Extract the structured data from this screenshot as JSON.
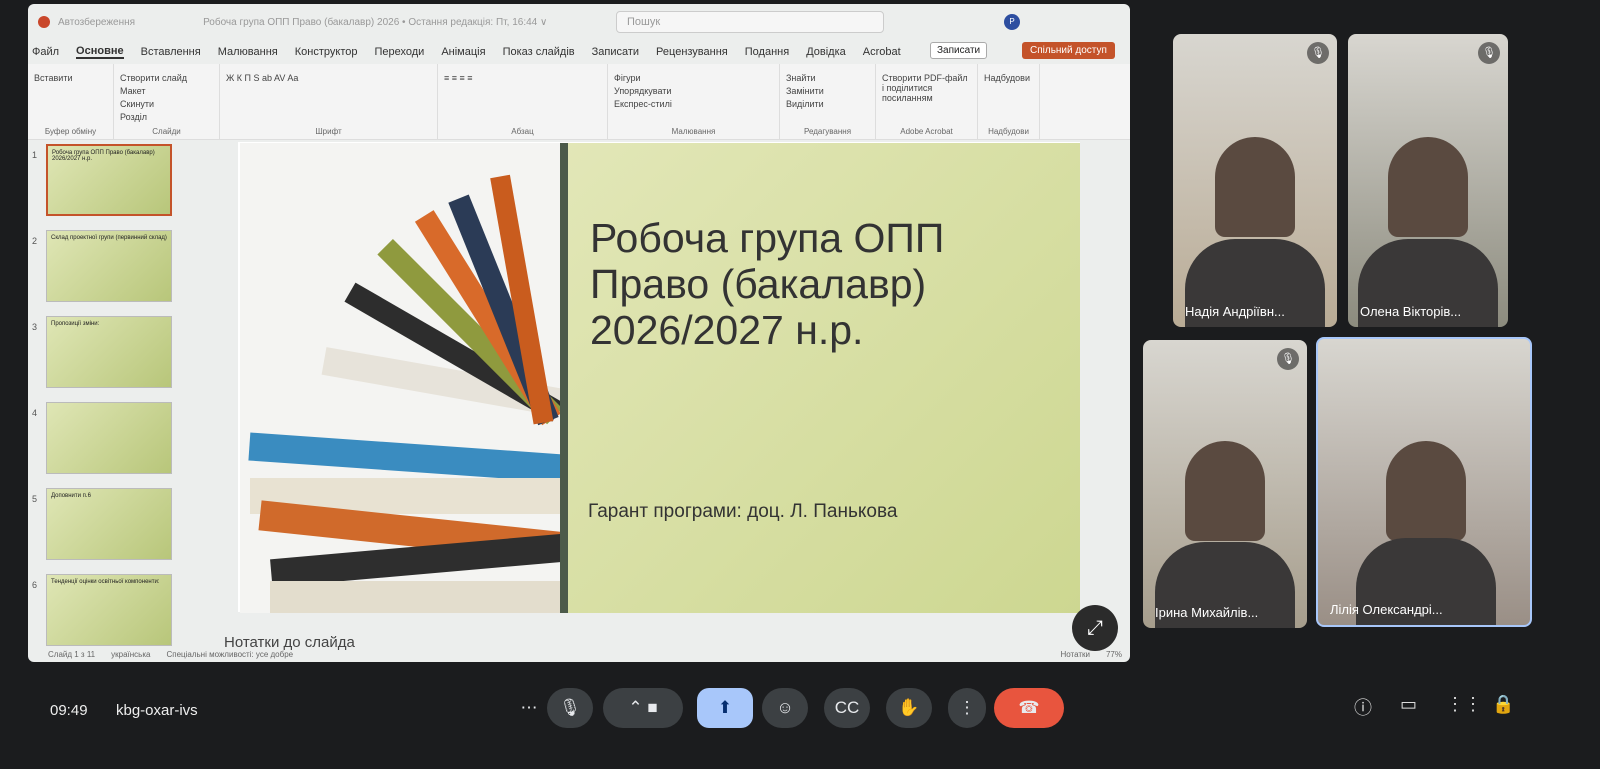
{
  "ppt": {
    "autosave": "Автозбереження",
    "doc_title": "Робоча група ОПП Право (бакалавр) 2026 • Остання редакція: Пт, 16:44 ∨",
    "search_placeholder": "Пошук",
    "avatar": "P",
    "menu": [
      "Файл",
      "Основне",
      "Вставлення",
      "Малювання",
      "Конструктор",
      "Переходи",
      "Анімація",
      "Показ слайдів",
      "Записати",
      "Рецензування",
      "Подання",
      "Довідка",
      "Acrobat"
    ],
    "record": "Записати",
    "share": "Спільний доступ",
    "ribbon": [
      {
        "label": "Буфер обміну",
        "items": [
          "Вставити"
        ]
      },
      {
        "label": "Слайди",
        "items": [
          "Створити слайд",
          "Макет",
          "Скинути",
          "Розділ"
        ]
      },
      {
        "label": "Шрифт",
        "items": [
          "Ж  К  П  S  ab  AV  Aa"
        ]
      },
      {
        "label": "Абзац",
        "items": [
          "≡ ≡ ≡ ≡"
        ]
      },
      {
        "label": "Малювання",
        "items": [
          "Фігури",
          "Упорядкувати",
          "Експрес-стилі"
        ]
      },
      {
        "label": "Редагування",
        "items": [
          "Знайти",
          "Замінити",
          "Виділити"
        ]
      },
      {
        "label": "Adobe Acrobat",
        "items": [
          "Створити PDF-файл і поділитися посиланням"
        ]
      },
      {
        "label": "Надбудови",
        "items": [
          "Надбудови"
        ]
      }
    ],
    "thumbnails": [
      {
        "num": "1",
        "text": "Робоча група ОПП Право (бакалавр) 2026/2027 н.р."
      },
      {
        "num": "2",
        "text": "Склад проектної групи (первинний склад)"
      },
      {
        "num": "3",
        "text": "Пропозиції зміни:"
      },
      {
        "num": "4",
        "text": ""
      },
      {
        "num": "5",
        "text": "Доповнити п.6"
      },
      {
        "num": "6",
        "text": "Тенденції оцінки освітньої компоненти:"
      }
    ],
    "slide": {
      "title": "Робоча група ОПП Право (бакалавр) 2026/2027 н.р.",
      "subtitle": "Гарант програми: доц. Л. Панькова"
    },
    "notes": "Нотатки до слайда",
    "status": {
      "slide": "Слайд 1 з 11",
      "lang": "українська",
      "access": "Спеціальні можливості: усе добре",
      "notes_btn": "Нотатки",
      "zoom": "77%"
    }
  },
  "meet": {
    "time": "09:49",
    "meeting_code": "kbg-oxar-ivs",
    "participants": [
      {
        "name": "Надія Андріївн...",
        "muted": true
      },
      {
        "name": "Олена Вікторів...",
        "muted": true
      },
      {
        "name": "Ірина Михайлів...",
        "muted": true
      },
      {
        "name": "Лілія Олександрі...",
        "muted": false
      }
    ],
    "colors": {
      "end_call": "#e8553e",
      "present_active": "#a8c7fa"
    }
  }
}
